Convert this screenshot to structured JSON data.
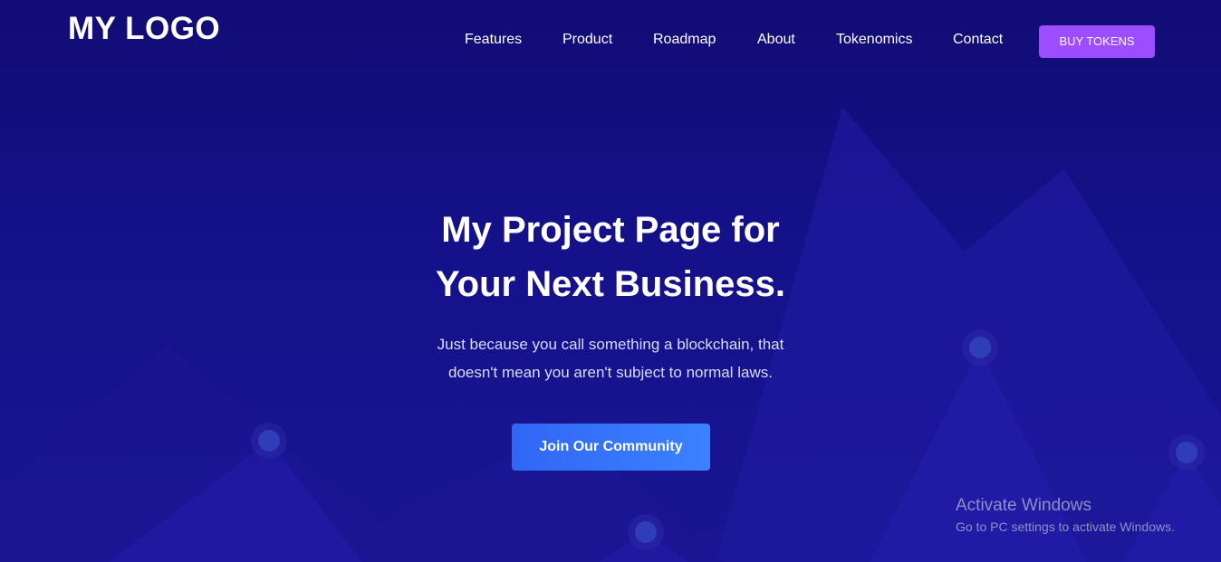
{
  "header": {
    "logo": "MY LOGO",
    "nav": [
      {
        "label": "Features",
        "icon": null
      },
      {
        "label": "Product",
        "icon": null
      },
      {
        "label": "Roadmap",
        "icon": null
      },
      {
        "label": "About",
        "icon": null
      },
      {
        "label": "Tokenomics",
        "icon": null
      },
      {
        "label": "Contact",
        "icon": null
      }
    ],
    "cta_label": "BUY TOKENS"
  },
  "hero": {
    "title_line1": "My Project Page for",
    "title_line2": "Your Next Business.",
    "subtitle_line1": "Just because you call something a blockchain, that",
    "subtitle_line2": "doesn't mean you aren't subject to normal laws.",
    "cta_label": "Join Our Community"
  },
  "watermark": {
    "title": "Activate Windows",
    "text": "Go to PC settings to activate Windows."
  },
  "colors": {
    "background": "#14108a",
    "buy_button": "#9b4dff",
    "cta_button": "#3a74f8",
    "decor_shape": "#2a22b0"
  }
}
